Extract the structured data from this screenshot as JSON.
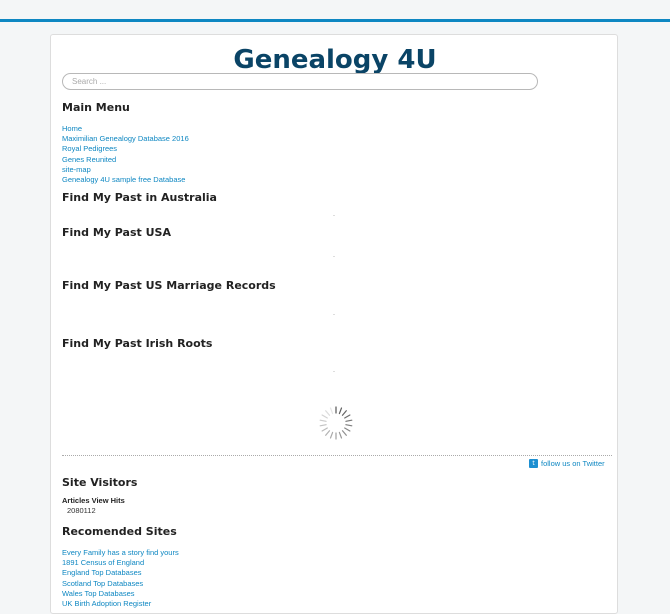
{
  "site_title": "Genealogy 4U",
  "search": {
    "placeholder": "Search ..."
  },
  "main_menu": {
    "title": "Main Menu",
    "items": [
      "Home",
      "Maximilian Genealogy Database 2016",
      "Royal Pedigrees",
      "Genes Reunited",
      "site-map",
      "Genealogy 4U sample free Database"
    ]
  },
  "sections": [
    "Find My Past in Australia",
    "Find My Past USA",
    "Find My Past US Marriage Records",
    "Find My Past Irish Roots"
  ],
  "twitter": {
    "icon_text": "t",
    "label": "follow us on Twitter"
  },
  "site_visitors": {
    "title": "Site Visitors",
    "subtitle": "Articles View Hits",
    "count": "2080112"
  },
  "recommended": {
    "title": "Recomended Sites",
    "items": [
      "Every Family has a story find yours",
      "1891 Census of England",
      "England Top Databases",
      "Scotland Top Databases",
      "Wales Top Databases",
      "UK Birth Adoption Register"
    ]
  },
  "colors": {
    "accent": "#0e87c2",
    "title": "#0a4466"
  }
}
